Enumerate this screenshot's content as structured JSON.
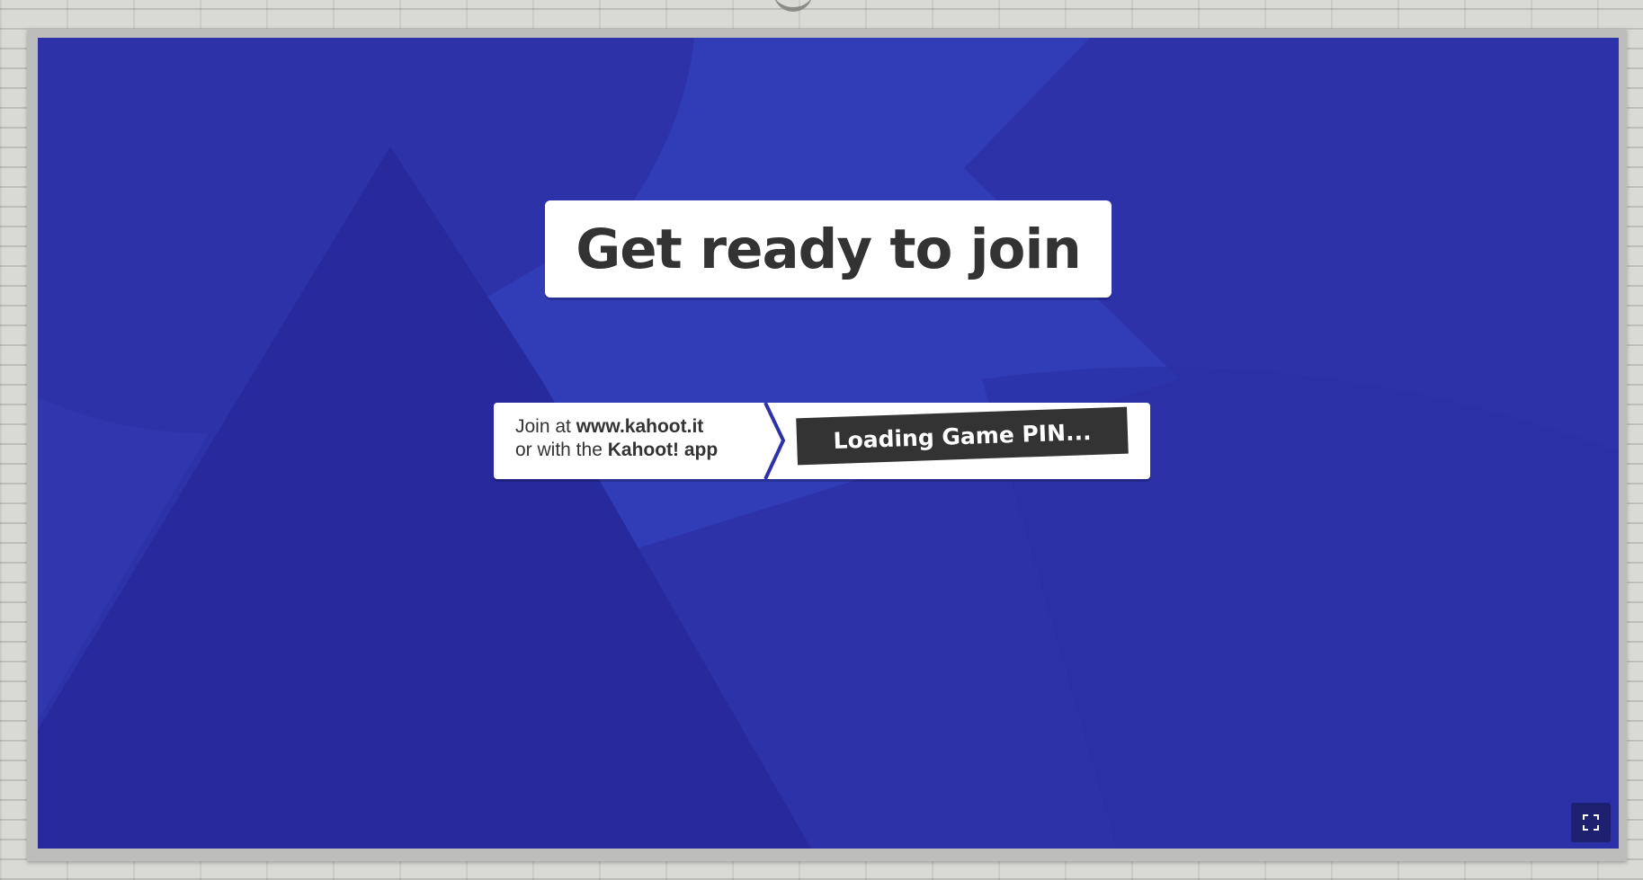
{
  "screen": {
    "title": "Get ready to join",
    "join_info": {
      "line1_prefix": "Join at",
      "line1_url": "www.kahoot.it",
      "line2_prefix": "or with the",
      "line2_app": "Kahoot! app"
    },
    "pin_status": "Loading Game PIN..."
  },
  "controls": {
    "fullscreen_icon": "fullscreen-icon"
  },
  "colors": {
    "background": "#2d32a8",
    "shape_light": "#3440b8",
    "shape_dark": "#26299a",
    "card": "#ffffff",
    "text_dark": "#333333",
    "pin_box": "#333333",
    "button_dark": "#1e2170"
  }
}
